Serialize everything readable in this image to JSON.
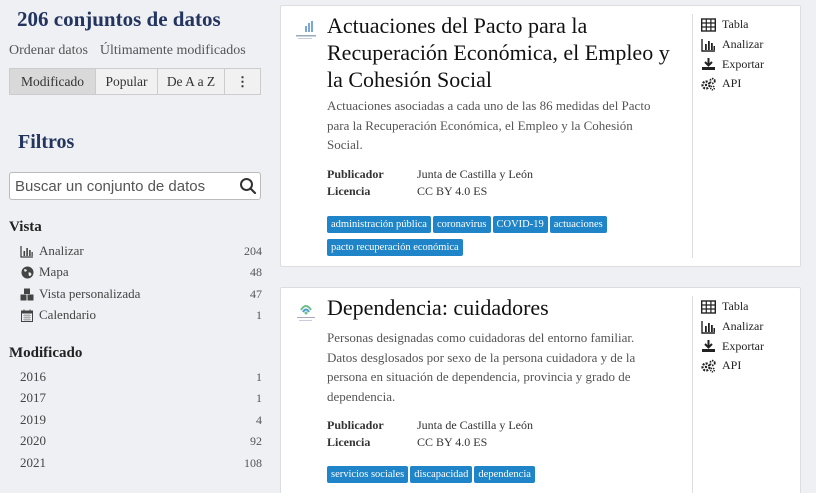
{
  "sidebar": {
    "count_title": "206 conjuntos de datos",
    "sort_label": "Ordenar datos",
    "sort_current": "Últimamente modificados",
    "sort_buttons": [
      "Modificado",
      "Popular",
      "De A a Z",
      "⋮"
    ],
    "filters_title": "Filtros",
    "search_placeholder": "Buscar un conjunto de datos",
    "vista_title": "Vista",
    "vista_items": [
      {
        "label": "Analizar",
        "count": "204",
        "icon": "bar-chart-icon"
      },
      {
        "label": "Mapa",
        "count": "48",
        "icon": "globe-icon"
      },
      {
        "label": "Vista personalizada",
        "count": "47",
        "icon": "cubes-icon"
      },
      {
        "label": "Calendario",
        "count": "1",
        "icon": "calendar-icon"
      }
    ],
    "modificado_title": "Modificado",
    "modificado_items": [
      {
        "label": "2016",
        "count": "1"
      },
      {
        "label": "2017",
        "count": "1"
      },
      {
        "label": "2019",
        "count": "4"
      },
      {
        "label": "2020",
        "count": "92"
      },
      {
        "label": "2021",
        "count": "108"
      }
    ]
  },
  "datasets": [
    {
      "title": "Actuaciones del Pacto para la Recuperación Económica, el Empleo y la Cohesión Social",
      "description": "Actuaciones asociadas a cada uno de las 86 medidas del Pacto para la Recuperación Económica, el Empleo y la Cohesión Social.",
      "publisher_label": "Publicador",
      "publisher": "Junta de Castilla y León",
      "license_label": "Licencia",
      "license": "CC BY 4.0 ES",
      "tags": [
        "administración pública",
        "coronavirus",
        "COVID-19",
        "actuaciones",
        "pacto recuperación económica"
      ]
    },
    {
      "title": "Dependencia: cuidadores",
      "description": "Personas designadas como cuidadoras del entorno familiar. Datos desglosados por sexo de la persona cuidadora y de la persona en situación de dependencia, provincia y grado de dependencia.",
      "publisher_label": "Publicador",
      "publisher": "Junta de Castilla y León",
      "license_label": "Licencia",
      "license": "CC BY 4.0 ES",
      "tags": [
        "servicios sociales",
        "discapacidad",
        "dependencia"
      ]
    }
  ],
  "actions": [
    "Tabla",
    "Analizar",
    "Exportar",
    "API"
  ],
  "colors": {
    "accent": "#1f84c8",
    "heading": "#23345e",
    "background": "#eef0f4"
  }
}
